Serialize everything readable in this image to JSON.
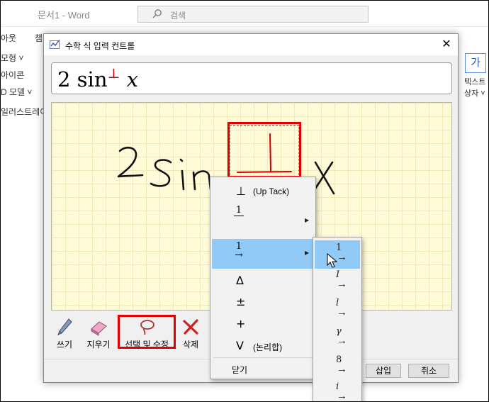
{
  "word": {
    "title": "문서1  -  Word",
    "search_placeholder": "검색",
    "left_items": [
      "아웃",
      "모형 ˅",
      "아이콘",
      "D 모델 ˅",
      "일러스트레이"
    ],
    "tab_fragment": "챔",
    "right_box": "가",
    "right_labels": [
      "텍스트",
      "상자 ˅"
    ]
  },
  "dialog": {
    "title": "수학 식 입력 컨트롤",
    "close_glyph": "✕",
    "preview": {
      "coefficient": "2 ",
      "function": "sin",
      "superscript": "⊥",
      "variable": "x"
    },
    "tools": {
      "write": "쓰기",
      "erase": "지우기",
      "select": "선택 및 수정",
      "delete": "삭제"
    },
    "buttons": {
      "insert": "삽입",
      "cancel": "취소"
    }
  },
  "context_menu": {
    "items": [
      {
        "symbol": "⊥",
        "text": "(Up Tack)"
      },
      {
        "fraction": "1",
        "has_submenu": true
      },
      {
        "fraction": "1",
        "arrow": "→",
        "has_submenu": true,
        "highlighted": true
      },
      {
        "symbol": "Δ"
      },
      {
        "symbol": "±"
      },
      {
        "symbol": "+"
      },
      {
        "symbol": "V",
        "text": "(논리합)"
      }
    ],
    "close": "닫기"
  },
  "submenu": {
    "items": [
      {
        "char": "1",
        "arrow": "→",
        "highlighted": true
      },
      {
        "char": "I",
        "arrow": "→"
      },
      {
        "char": "l",
        "arrow": "→"
      },
      {
        "char": "γ",
        "arrow": "→"
      },
      {
        "char": "8",
        "arrow": "→"
      },
      {
        "char": "i",
        "arrow": "→"
      }
    ]
  },
  "colors": {
    "highlight": "#91c9f7",
    "annotation_red": "#e00000",
    "canvas_bg": "#fffbd9",
    "ink_red": "#d40000"
  }
}
